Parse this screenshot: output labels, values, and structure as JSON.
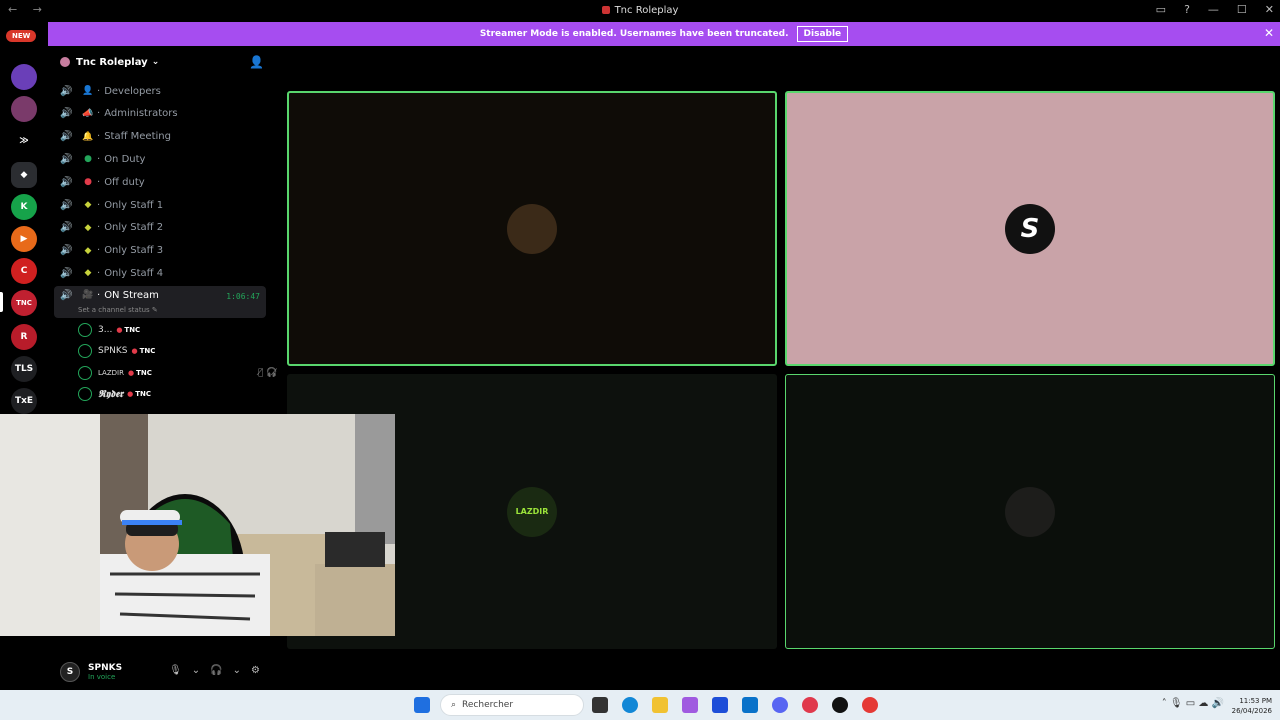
{
  "window": {
    "title": "Tnc Roleplay",
    "nav": "← →",
    "controls": [
      "▭",
      "?",
      "—",
      "☐",
      "✕"
    ]
  },
  "banner": {
    "text": "Streamer Mode is enabled. Usernames have been truncated.",
    "button": "Disable",
    "close": "✕"
  },
  "servers": {
    "new_badge": "NEW",
    "items": [
      {
        "label": "",
        "color": "#6a3fb8"
      },
      {
        "label": "",
        "color": "#7a3a6a"
      },
      {
        "label": "≫",
        "color": "#000000"
      },
      {
        "label": "◆",
        "color": "#2b2d31"
      },
      {
        "label": "K",
        "color": "#16a34a"
      },
      {
        "label": "▶",
        "color": "#e86a1a"
      },
      {
        "label": "C",
        "color": "#d02020"
      },
      {
        "label": "TNC",
        "color": "#c02030"
      },
      {
        "label": "R",
        "color": "#b81c2a"
      },
      {
        "label": "TLS",
        "color": "#1e1f22"
      },
      {
        "label": "TxE",
        "color": "#1e1f22"
      }
    ]
  },
  "sidebar": {
    "server_name": "Tnc Roleplay",
    "channels": [
      {
        "emoji": "👤",
        "name": "Developers",
        "color": "#c7a27a"
      },
      {
        "emoji": "📣",
        "name": "Administrators",
        "color": "#8a8a8a"
      },
      {
        "emoji": "🔔",
        "name": "Staff Meeting",
        "color": "#f0b232"
      },
      {
        "emoji": "●",
        "name": "On Duty",
        "color": "#23a55a"
      },
      {
        "emoji": "●",
        "name": "Off duty",
        "color": "#e23b4a"
      },
      {
        "emoji": "◆",
        "name": "Only Staff 1",
        "color": "#c7d23b"
      },
      {
        "emoji": "◆",
        "name": "Only Staff 2",
        "color": "#c7d23b"
      },
      {
        "emoji": "◆",
        "name": "Only Staff 3",
        "color": "#c7d23b"
      },
      {
        "emoji": "◆",
        "name": "Only Staff 4",
        "color": "#c7d23b"
      }
    ],
    "active_channel": {
      "emoji": "🎥",
      "name": "ON Stream",
      "timer": "1:06:47",
      "status": "Set a channel status ✎"
    },
    "members": [
      {
        "name": "3...",
        "tag": "TNC",
        "style": "normal"
      },
      {
        "name": "SPNKS",
        "tag": "TNC",
        "style": "normal"
      },
      {
        "name": "LAZDIR",
        "tag": "TNC",
        "style": "small",
        "icons": "🎙̸ 🎧̸"
      },
      {
        "name": "𝕽𝖞𝖉𝖊𝖗",
        "tag": "TNC",
        "style": "script"
      }
    ]
  },
  "user_panel": {
    "avatar": "S",
    "name": "SPNKS",
    "status": "In voice",
    "icons": [
      "🎙",
      "⌄",
      "🎧",
      "⌄",
      "⚙"
    ]
  },
  "tiles": [
    {
      "avatar_label": "",
      "avatar_color": "#3b2a18"
    },
    {
      "avatar_label": "S",
      "avatar_color": "#111111"
    },
    {
      "avatar_label": "LAZDIR",
      "avatar_color": "#1a2a12"
    },
    {
      "avatar_label": "",
      "avatar_color": "#1d1d1b"
    }
  ],
  "taskbar": {
    "search_placeholder": "Rechercher",
    "time": "11:53 PM",
    "date": "26/04/2026",
    "tray": "˄ 🎙 ▭ ☁ 🔊"
  }
}
